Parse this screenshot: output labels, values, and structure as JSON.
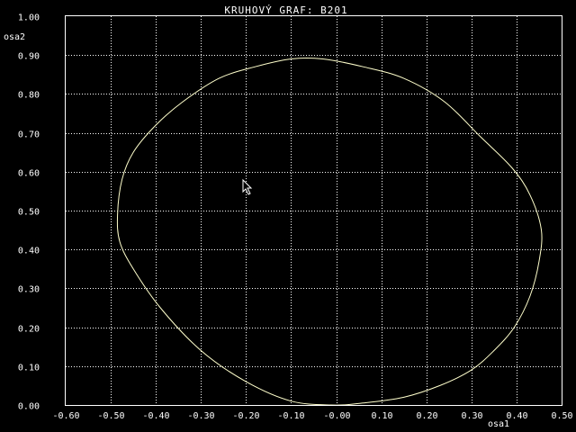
{
  "chart_data": {
    "type": "line",
    "title": "KRUHOVÝ GRAF: B201",
    "xlabel": "osa1",
    "ylabel": "osa2",
    "xlim": [
      -0.6,
      0.5
    ],
    "ylim": [
      0.0,
      1.0
    ],
    "grid": true,
    "x_ticks": [
      "-0.60",
      "-0.50",
      "-0.40",
      "-0.30",
      "-0.20",
      "-0.10",
      "-0.00",
      "0.10",
      "0.20",
      "0.30",
      "0.40",
      "0.50"
    ],
    "y_ticks": [
      "0.00",
      "0.10",
      "0.20",
      "0.30",
      "0.40",
      "0.50",
      "0.60",
      "0.70",
      "0.80",
      "0.90",
      "1.00"
    ],
    "series": [
      {
        "color": "#ffffcc",
        "closed": true,
        "x": [
          -0.03,
          0.06,
          0.15,
          0.24,
          0.32,
          0.39,
          0.43,
          0.455,
          0.45,
          0.43,
          0.395,
          0.35,
          0.3,
          0.23,
          0.15,
          0.06,
          -0.01,
          -0.1,
          -0.2,
          -0.3,
          -0.39,
          -0.45,
          -0.48,
          -0.485,
          -0.475,
          -0.45,
          -0.4,
          -0.34,
          -0.26,
          -0.18,
          -0.1
        ],
        "y": [
          0.89,
          0.87,
          0.84,
          0.78,
          0.69,
          0.61,
          0.54,
          0.45,
          0.37,
          0.28,
          0.2,
          0.14,
          0.09,
          0.05,
          0.02,
          0.005,
          0.0,
          0.01,
          0.06,
          0.14,
          0.25,
          0.35,
          0.42,
          0.49,
          0.58,
          0.65,
          0.72,
          0.78,
          0.84,
          0.87,
          0.89
        ]
      }
    ]
  }
}
